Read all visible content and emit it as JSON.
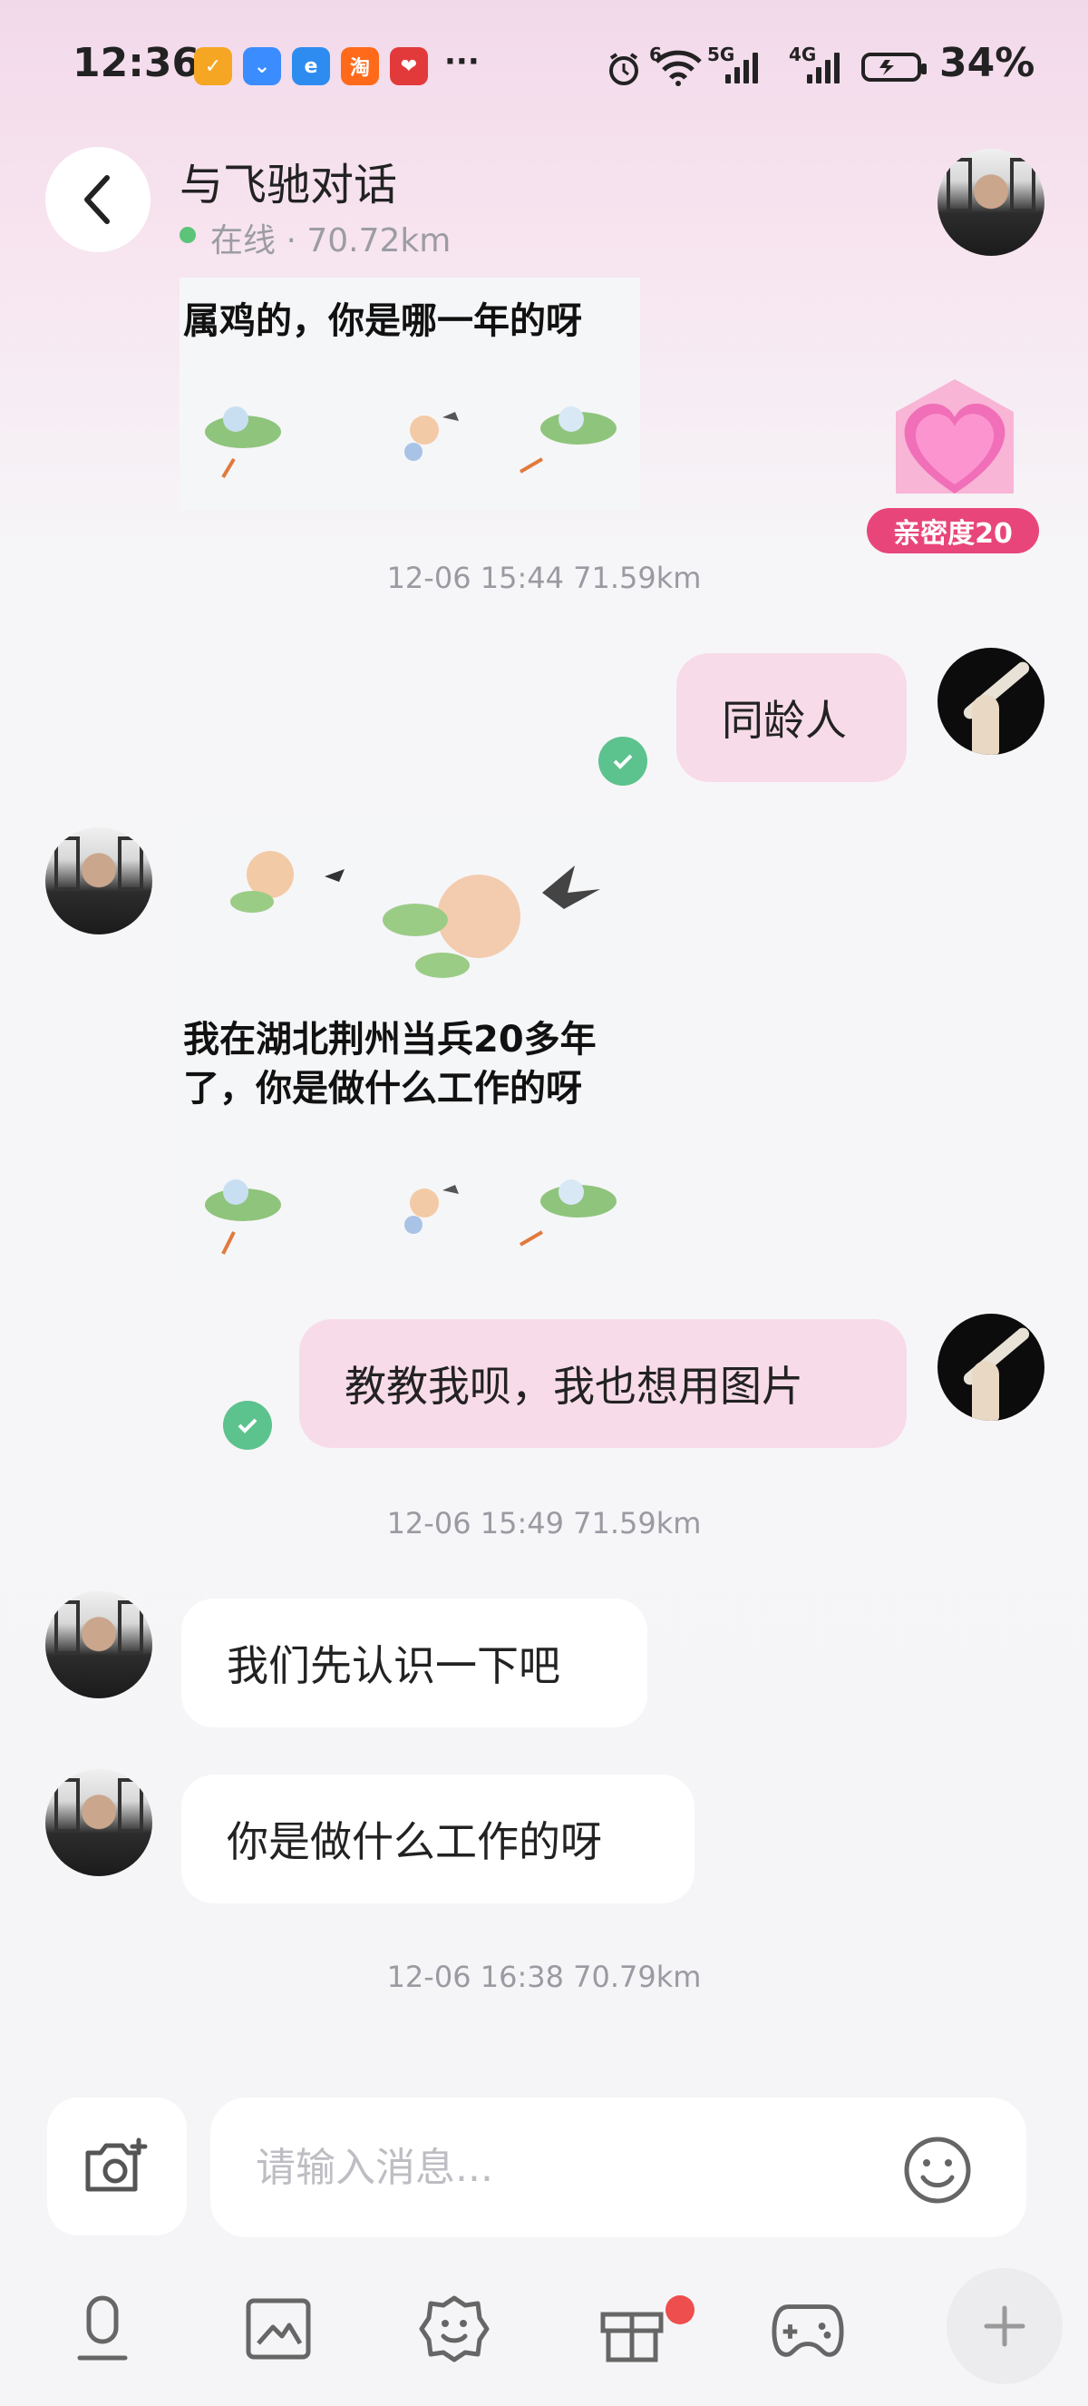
{
  "status_bar": {
    "time": "12:36",
    "battery": "34%",
    "network_labels": [
      "6",
      "5G",
      "4G"
    ],
    "app_icons": [
      {
        "name": "app-icon-orange",
        "color": "#f5a623",
        "glyph": "✓"
      },
      {
        "name": "app-icon-blue",
        "color": "#3b8cff",
        "glyph": "⌄"
      },
      {
        "name": "app-icon-eleme",
        "color": "#2e8cf0",
        "glyph": "e"
      },
      {
        "name": "app-icon-taobao",
        "color": "#ff6a1a",
        "glyph": "淘"
      },
      {
        "name": "app-icon-red",
        "color": "#e23a3a",
        "glyph": "❤"
      }
    ],
    "more": "···"
  },
  "header": {
    "title": "与飞驰对话",
    "status": "在线 · 70.72km"
  },
  "intimacy": {
    "label": "亲密度20"
  },
  "messages": {
    "image1_text": "属鸡的，你是哪一年的呀",
    "ts1": "12-06 15:44  71.59km",
    "sent1": "同龄人",
    "image2_text_line1": "我在湖北荆州当兵20多年",
    "image2_text_line2": "了，你是做什么工作的呀",
    "sent2": "教教我呗，我也想用图片",
    "ts2": "12-06 15:49  71.59km",
    "recv1": "我们先认识一下吧",
    "recv2": "你是做什么工作的呀",
    "ts3": "12-06 16:38  70.79km"
  },
  "input": {
    "placeholder": "请输入消息..."
  },
  "colors": {
    "sent_bubble": "#f8dbe8",
    "online": "#5bc479",
    "check": "#5cc28e",
    "badge": "#e8467a"
  }
}
